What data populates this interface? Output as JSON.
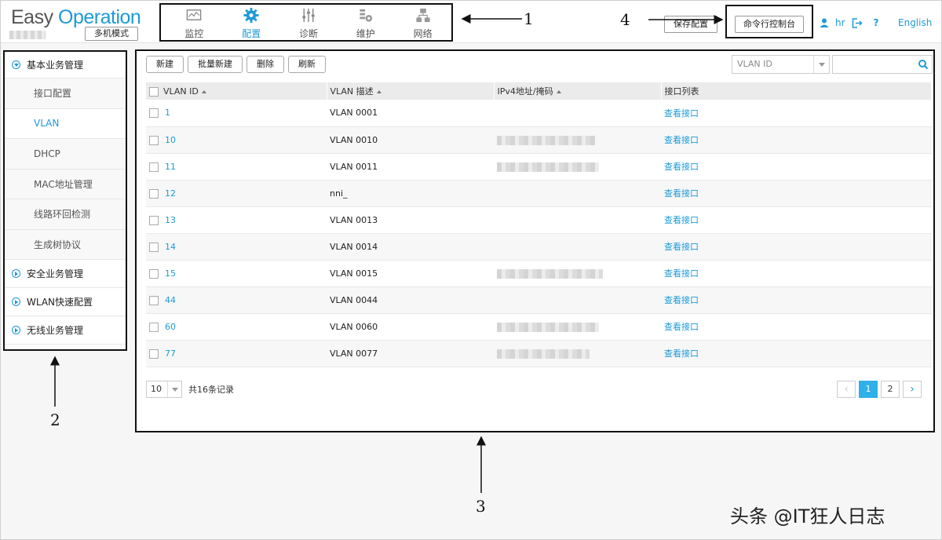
{
  "brand": {
    "part1": "Easy ",
    "part2": "Operation",
    "mode_button": "多机模式"
  },
  "nav": [
    {
      "label": "监控",
      "icon": "monitor-icon"
    },
    {
      "label": "配置",
      "icon": "gear-icon",
      "active": true
    },
    {
      "label": "诊断",
      "icon": "sliders-icon"
    },
    {
      "label": "维护",
      "icon": "wrench-gear-icon"
    },
    {
      "label": "网络",
      "icon": "network-icon"
    }
  ],
  "header": {
    "save_label": "保存配置",
    "cli_label": "命令行控制台",
    "user": "hr",
    "help": "?",
    "language": "English"
  },
  "sidebar": {
    "group1": "基本业务管理",
    "items": [
      "接口配置",
      "VLAN",
      "DHCP",
      "MAC地址管理",
      "线路环回检测",
      "生成树协议"
    ],
    "group2": "安全业务管理",
    "group3": "WLAN快速配置",
    "group4": "无线业务管理"
  },
  "toolbar": {
    "new": "新建",
    "batch_new": "批量新建",
    "delete": "删除",
    "refresh": "刷新"
  },
  "search": {
    "field": "VLAN ID",
    "placeholder": ""
  },
  "table": {
    "columns": [
      "VLAN ID",
      "VLAN 描述",
      "IPv4地址/掩码",
      "接口列表"
    ],
    "rows": [
      {
        "id": "1",
        "desc": "VLAN 0001",
        "port": "查看接口"
      },
      {
        "id": "10",
        "desc": "VLAN 0010",
        "port": "查看接口"
      },
      {
        "id": "11",
        "desc": "VLAN 0011",
        "port": "查看接口"
      },
      {
        "id": "12",
        "desc": "nni_",
        "port": "查看接口"
      },
      {
        "id": "13",
        "desc": "VLAN 0013",
        "port": "查看接口"
      },
      {
        "id": "14",
        "desc": "VLAN 0014",
        "port": "查看接口"
      },
      {
        "id": "15",
        "desc": "VLAN 0015",
        "port": "查看接口"
      },
      {
        "id": "44",
        "desc": "VLAN 0044",
        "port": "查看接口"
      },
      {
        "id": "60",
        "desc": "VLAN 0060",
        "port": "查看接口"
      },
      {
        "id": "77",
        "desc": "VLAN 0077",
        "port": "查看接口"
      }
    ]
  },
  "footer": {
    "page_size": "10",
    "total": "共16条记录",
    "pages": [
      "1",
      "2"
    ],
    "prev": "‹",
    "next": "›"
  },
  "callouts": {
    "c1": "1",
    "c2": "2",
    "c3": "3",
    "c4": "4"
  },
  "watermark": "头条 @IT狂人日志"
}
